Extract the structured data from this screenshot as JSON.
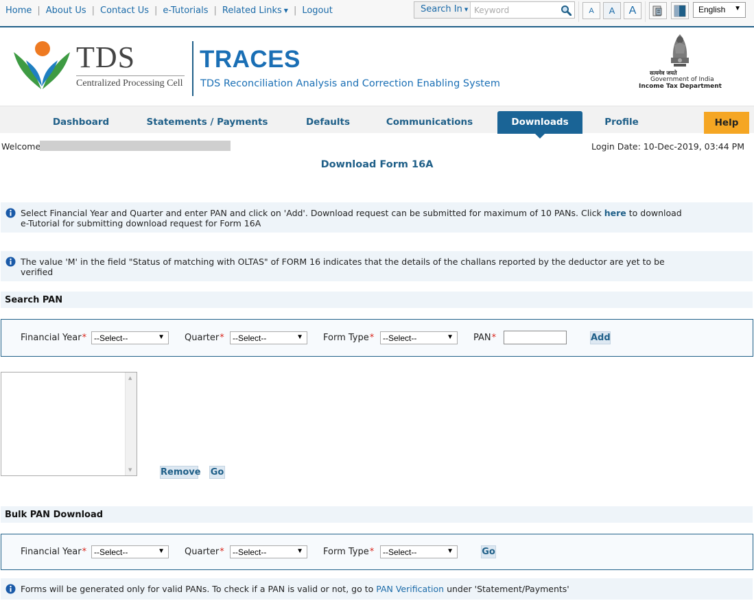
{
  "topbar": {
    "links": [
      "Home",
      "About Us",
      "Contact Us",
      "e-Tutorials",
      "Related Links",
      "Logout"
    ],
    "search_in_label": "Search In",
    "keyword_placeholder": "Keyword",
    "font_buttons": [
      "A",
      "A",
      "A"
    ],
    "language": "English"
  },
  "header": {
    "logo_text": "TDS",
    "logo_subtitle": "Centralized Processing Cell",
    "app_name": "TRACES",
    "app_tagline": "TDS Reconciliation Analysis and Correction Enabling System",
    "emblem_motto": "सत्यमेव जयते",
    "gov_line1": "Government of India",
    "gov_line2": "Income Tax Department"
  },
  "nav": {
    "items": [
      "Dashboard",
      "Statements / Payments",
      "Defaults",
      "Communications",
      "Downloads",
      "Profile",
      "Help"
    ],
    "active": "Downloads"
  },
  "session": {
    "welcome_label": "Welcome",
    "login_date": "Login Date: 10-Dec-2019, 03:44 PM"
  },
  "page": {
    "title": "Download Form 16A"
  },
  "info": {
    "msg1_pre": "Select Financial Year and Quarter and enter PAN and click on 'Add'. Download request can be submitted for maximum of 10 PANs. Click ",
    "msg1_link": "here",
    "msg1_post": " to download e-Tutorial for submitting download request for Form 16A",
    "msg2": "The value 'M' in the field \"Status of matching with OLTAS\" of FORM 16 indicates that the details of the challans reported by the deductor are yet to be verified",
    "msg3_pre": "Forms will be generated only for valid PANs. To check if a PAN is valid or not, go to ",
    "msg3_link": "PAN Verification",
    "msg3_post": " under 'Statement/Payments'"
  },
  "search_pan": {
    "heading": "Search PAN",
    "fy_label": "Financial Year",
    "quarter_label": "Quarter",
    "form_type_label": "Form Type",
    "pan_label": "PAN",
    "required_mark": "*",
    "select_default": "--Select--",
    "add_button": "Add",
    "remove_button": "Remove",
    "go_button": "Go"
  },
  "bulk": {
    "heading": "Bulk PAN Download",
    "go_button": "Go"
  },
  "colors": {
    "primary": "#1f5f88",
    "nav_active": "#1a6496",
    "help": "#f5a623",
    "info_bg": "#eef4f9",
    "required": "#d9261c"
  }
}
